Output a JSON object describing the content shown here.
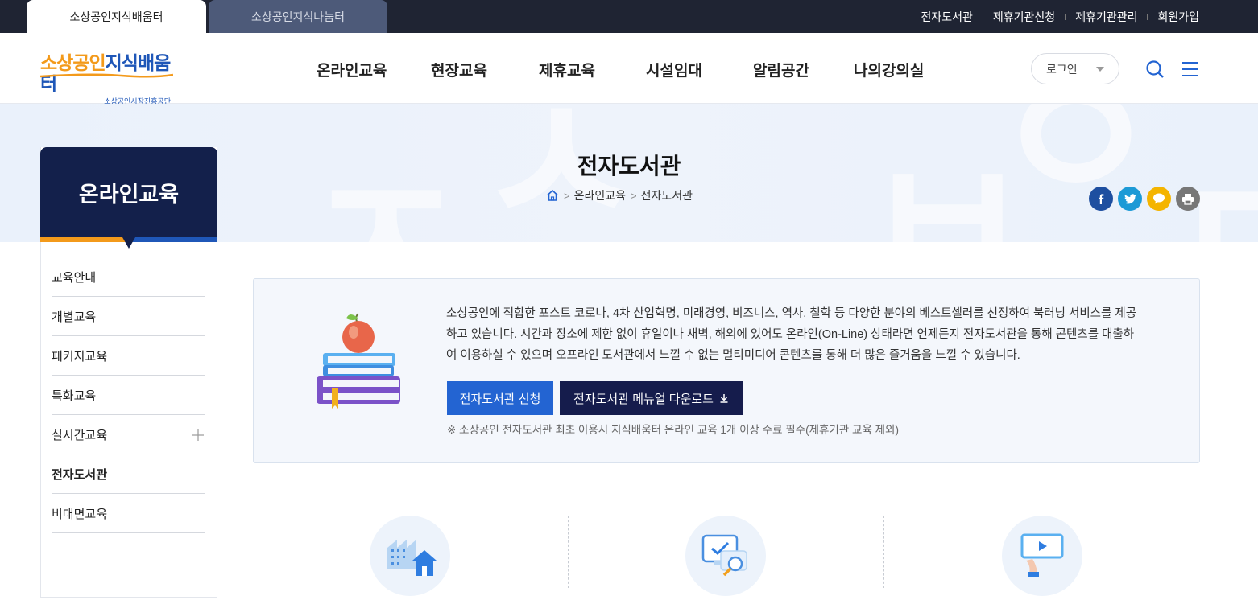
{
  "top_tabs": [
    {
      "label": "소상공인지식배움터"
    },
    {
      "label": "소상공인지식나눔터"
    }
  ],
  "util_links": [
    {
      "label": "전자도서관"
    },
    {
      "label": "제휴기관신청"
    },
    {
      "label": "제휴기관관리"
    },
    {
      "label": "회원가입"
    }
  ],
  "logo": {
    "part1": "소상공인",
    "part2": "지식배움터",
    "sub": "소상공인시장진흥공단"
  },
  "gnb": [
    {
      "label": "온라인교육"
    },
    {
      "label": "현장교육"
    },
    {
      "label": "제휴교육"
    },
    {
      "label": "시설임대"
    },
    {
      "label": "알림공간"
    },
    {
      "label": "나의강의실"
    }
  ],
  "login": {
    "label": "로그인"
  },
  "page": {
    "title": "전자도서관",
    "breadcrumb": [
      "온라인교육",
      "전자도서관"
    ]
  },
  "sidebar": {
    "title": "온라인교육",
    "items": [
      {
        "label": "교육안내"
      },
      {
        "label": "개별교육"
      },
      {
        "label": "패키지교육"
      },
      {
        "label": "특화교육"
      },
      {
        "label": "실시간교육"
      },
      {
        "label": "전자도서관"
      },
      {
        "label": "비대면교육"
      }
    ]
  },
  "intro": {
    "lines": [
      "소상공인에 적합한 포스트 코로나, 4차 산업혁명, 미래경영, 비즈니스, 역사, 철학 등 다양한 분야의 베스트셀러를 선정하여 북러닝 서비스를 제공",
      "하고 있습니다. 시간과 장소에 제한 없이 휴일이나 새벽, 해외에 있어도 온라인(On-Line) 상태라면 언제든지 전자도서관을 통해 콘텐츠를 대출하",
      "여 이용하실 수 있으며 오프라인 도서관에서 느낄 수 없는 멀티미디어 콘텐츠를 통해 더 많은 즐거움을 느낄 수 있습니다."
    ],
    "btn_apply": "전자도서관 신청",
    "btn_manual": "전자도서관 메뉴얼 다운로드",
    "note": "※ 소상공인 전자도서관 최초 이용시 지식배움터 온라인 교육 1개 이상 수료 필수(제휴기관 교육 제외)"
  },
  "colors": {
    "topbar": "#1f2433",
    "navy": "#13204b",
    "blue": "#2364d2",
    "orange": "#f39a1b",
    "facebook": "#1e4fa0",
    "twitter": "#1d9ad6",
    "kakao": "#f4b400",
    "print": "#777777"
  },
  "hero_glyphs": [
    "ㅈ",
    "ㅅ",
    "ㅂ",
    "ㅇ",
    "ㄷ"
  ]
}
